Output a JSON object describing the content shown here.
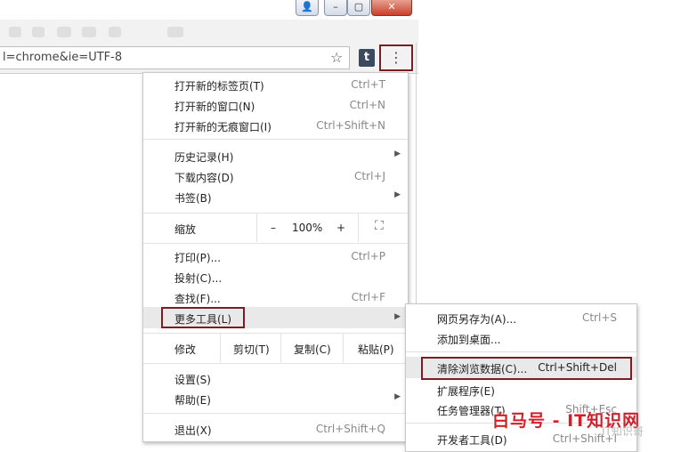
{
  "window_controls": {
    "user": "👤",
    "minimize": "–",
    "maximize": "▢",
    "close": "✕"
  },
  "toolbar": {
    "url": "l=chrome&ie=UTF-8",
    "star": "☆",
    "tumblr": "t",
    "menu_icon": "⋮"
  },
  "menu": {
    "new_tab": {
      "label": "打开新的标签页(T)",
      "shortcut": "Ctrl+T"
    },
    "new_window": {
      "label": "打开新的窗口(N)",
      "shortcut": "Ctrl+N"
    },
    "incognito": {
      "label": "打开新的无痕窗口(I)",
      "shortcut": "Ctrl+Shift+N"
    },
    "history": {
      "label": "历史记录(H)"
    },
    "downloads": {
      "label": "下载内容(D)",
      "shortcut": "Ctrl+J"
    },
    "bookmarks": {
      "label": "书签(B)"
    },
    "zoom": {
      "label": "缩放",
      "minus": "–",
      "value": "100%",
      "plus": "+",
      "fullscreen": "⛶"
    },
    "print": {
      "label": "打印(P)...",
      "shortcut": "Ctrl+P"
    },
    "cast": {
      "label": "投射(C)..."
    },
    "find": {
      "label": "查找(F)...",
      "shortcut": "Ctrl+F"
    },
    "more_tools": {
      "label": "更多工具(L)"
    },
    "edit": {
      "label": "修改",
      "cut": "剪切(T)",
      "copy": "复制(C)",
      "paste": "粘贴(P)"
    },
    "settings": {
      "label": "设置(S)"
    },
    "help": {
      "label": "帮助(E)"
    },
    "exit": {
      "label": "退出(X)",
      "shortcut": "Ctrl+Shift+Q"
    },
    "submenu_arrow": "▶"
  },
  "submenu": {
    "save_page": {
      "label": "网页另存为(A)...",
      "shortcut": "Ctrl+S"
    },
    "add_to_desktop": {
      "label": "添加到桌面..."
    },
    "clear_data": {
      "label": "清除浏览数据(C)...",
      "shortcut": "Ctrl+Shift+Del"
    },
    "extensions": {
      "label": "扩展程序(E)"
    },
    "task_manager": {
      "label": "任务管理器(T)",
      "shortcut": "Shift+Esc"
    },
    "dev_tools": {
      "label": "开发者工具(D)",
      "shortcut": "Ctrl+Shift+I"
    }
  },
  "watermark": {
    "text": "白马号 - IT知识网",
    "sub": "IT知识哥"
  }
}
